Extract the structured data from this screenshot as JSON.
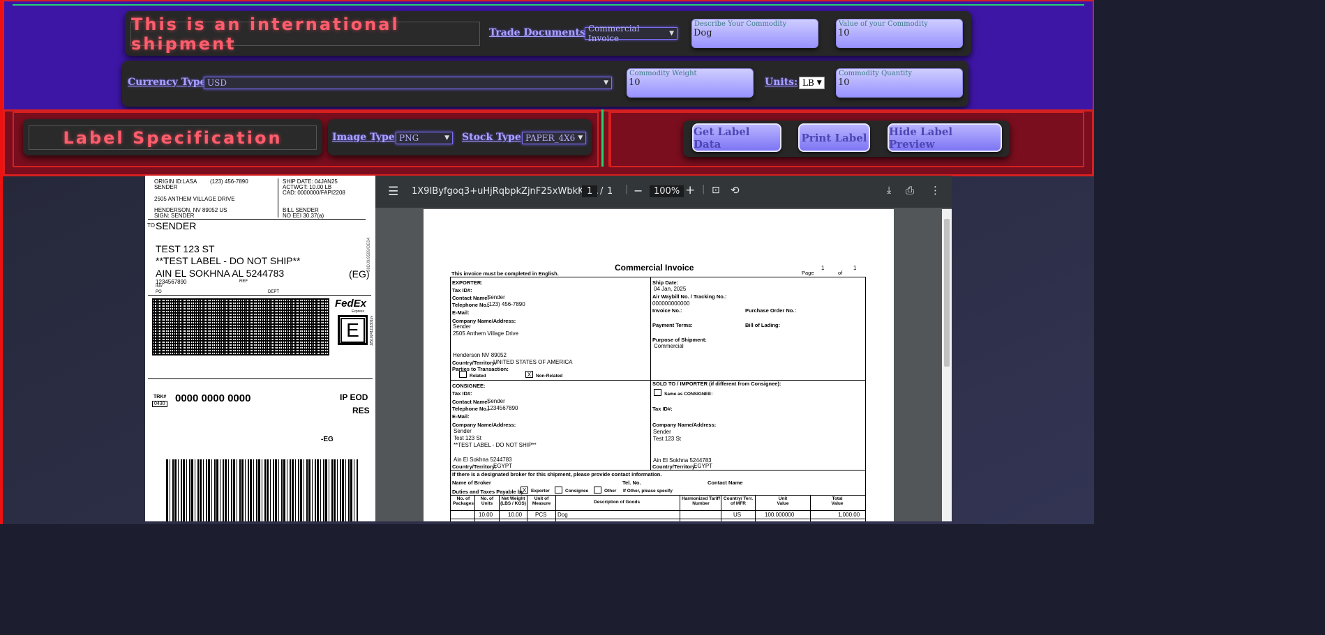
{
  "shipment": {
    "intl_title": "This is an international shipment",
    "trade_docs_label": "Trade Documents:",
    "trade_docs_value": "Commercial Invoice",
    "describe_ph": "Describe Your Commodity",
    "describe_val": "Dog",
    "value_ph": "Value of your Commodity",
    "value_val": "10",
    "currency_label": "Currency Type",
    "currency_value": "USD",
    "weight_ph": "Commodity Weight",
    "weight_val": "10",
    "units_label": "Units:",
    "units_value": "LB",
    "qty_ph": "Commodity Quantity",
    "qty_val": "10"
  },
  "spec": {
    "title": "Label Specification",
    "image_type_label": "Image Type",
    "image_type_value": "PNG",
    "stock_type_label": "Stock Type",
    "stock_type_value": "PAPER_4X6"
  },
  "buttons": {
    "get": "Get Label Data",
    "print": "Print Label",
    "hide": "Hide Label Preview"
  },
  "label": {
    "origin": "ORIGIN ID:LASA",
    "phone": "(123) 456-7890",
    "sender_top": "SENDER",
    "addr1": "2505 ANTHEM VILLAGE DRIVE",
    "addr2": "HENDERSON, NV 89052 US",
    "sign": "SIGN: SENDER",
    "ship_date": "SHIP DATE: 04JAN25",
    "actwgt": "ACTWGT: 10.00 LB",
    "cad": "CAD: 0000000/FAPI2208",
    "bill": "BILL SENDER",
    "eei": "NO EEI 30.37(a)",
    "to": "TO",
    "to_name": "SENDER",
    "to_st": "TEST 123 ST",
    "to_note": "**TEST LABEL - DO NOT SHIP**",
    "to_city": "AIN EL SOKHNA AL 5244783",
    "country": "(EG)",
    "phone2": "1234567890",
    "ref": "REF",
    "inv": "INV",
    "po": "PO",
    "dept": "DEPT",
    "side_code": "58DJ9/9599/DE04",
    "fedex": "FedEx",
    "express": "Express",
    "e": "E",
    "side2": "J2510241111301uv",
    "trk_label": "TRK#",
    "trk_code": "0430",
    "trk": "0000 0000 0000",
    "svc1": "IP EOD",
    "svc2": "RES",
    "dest": "-EG"
  },
  "viewer": {
    "filename": "1X9IByfgoq3+uHjRqbpkZjnF25xWbkKZ...",
    "page_cur": "1",
    "page_sep": "/",
    "page_total": "1",
    "zoom": "100%"
  },
  "invoice": {
    "title": "Commercial Invoice",
    "note": "This invoice must be completed in English.",
    "page_label": "Page",
    "page_num": "1",
    "of": "of",
    "page_tot": "1",
    "exporter": "EXPORTER:",
    "tax": "Tax ID#:",
    "contact": "Contact Name:",
    "contact_v": "Sender",
    "tel": "Telephone No.:",
    "tel_v": "(123) 456-7890",
    "email": "E-Mail:",
    "company": "Company Name/Address:",
    "c1": "Sender",
    "c2": "2505 Anthem Village Drive",
    "c3": "Henderson NV 89052",
    "country": "Country/Territory:",
    "country_v": "UNITED STATES OF AMERICA",
    "parties": "Parties to Transaction:",
    "related": "Related",
    "nonrel": "Non-Related",
    "x": "X",
    "ship_date": "Ship Date:",
    "ship_date_v": "04 Jan, 2025",
    "awb": "Air Waybill No. / Tracking No.:",
    "awb_v": "000000000000",
    "inv_no": "Invoice No.:",
    "po": "Purchase Order No.:",
    "pay": "Payment Terms:",
    "bol": "Bill of Lading:",
    "purpose": "Purpose of Shipment:",
    "purpose_v": "Commercial",
    "consignee": "CONSIGNEE:",
    "cphone": "1234567890",
    "cc2": "Test 123 St",
    "cc3": "**TEST LABEL - DO NOT SHIP**",
    "cc4": "Ain El Sokhna  5244783",
    "ccountry": "EGYPT",
    "sold": "SOLD TO / IMPORTER (if different from Consignee):",
    "same": "Same as CONSIGNEE:",
    "broker_note": "If there is a designated broker for this shipment, please provide contact information.",
    "broker": "Name of Broker",
    "brtel": "Tel. No.",
    "brcontact": "Contact Name",
    "duties": "Duties and Taxes Payable by",
    "exp": "Exporter",
    "cons": "Consignee",
    "other": "Other",
    "ifother": "If Other, please specify",
    "h_pkg": "No. of Packages",
    "h_units": "No. of Units",
    "h_netwt": "Net Weight (LBS / KGS)",
    "h_uom": "Unit of Measure",
    "h_desc": "Description of Goods",
    "h_hts": "Harmonized Tariff Number",
    "h_cty": "Country/ Terr. of MFR",
    "h_uval": "Unit Value",
    "h_tval": "Total Value",
    "r_units": "10.00",
    "r_wt": "10.00",
    "r_uom": "PCS",
    "r_desc": "Dog",
    "r_cty": "US",
    "r_uval": "100.000000",
    "r_tval": "1,000.00"
  }
}
